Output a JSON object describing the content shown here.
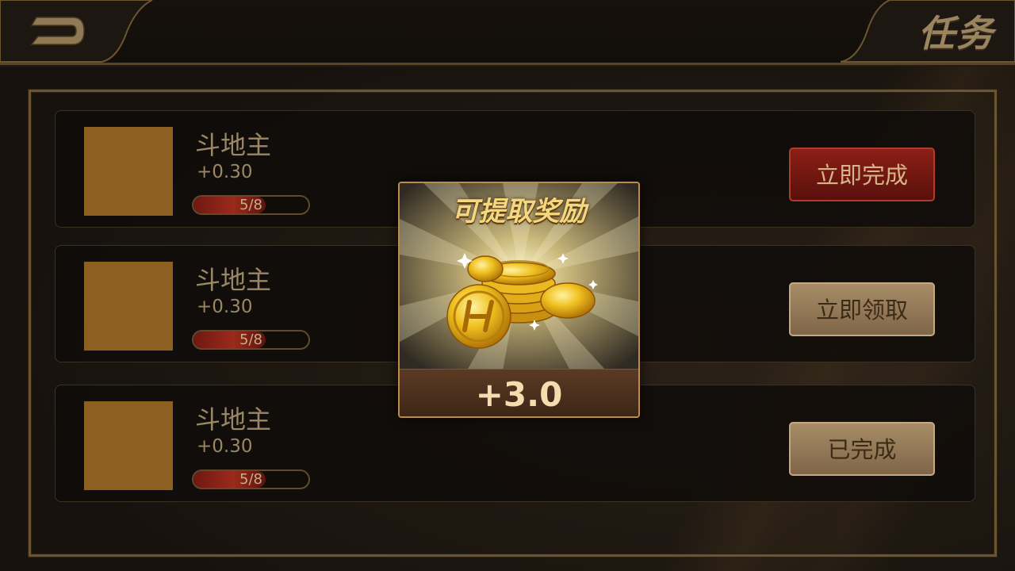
{
  "header": {
    "title": "任务"
  },
  "tasks": [
    {
      "name": "斗地主",
      "reward": "+0.30",
      "progress_text": "5/8",
      "progress": 0.625,
      "button_label": "立即完成",
      "button_style": "red"
    },
    {
      "name": "斗地主",
      "reward": "+0.30",
      "progress_text": "5/8",
      "progress": 0.625,
      "button_label": "立即领取",
      "button_style": "gold"
    },
    {
      "name": "斗地主",
      "reward": "+0.30",
      "progress_text": "5/8",
      "progress": 0.625,
      "button_label": "已完成",
      "button_style": "gold"
    }
  ],
  "popup": {
    "title": "可提取奖励",
    "amount": "+3.0",
    "icon": "gold-coins-icon"
  },
  "colors": {
    "accent_gold": "#b98d4c",
    "button_red": "#8b1f16",
    "button_gold": "#a88c67",
    "thumb": "#8d5f21"
  }
}
